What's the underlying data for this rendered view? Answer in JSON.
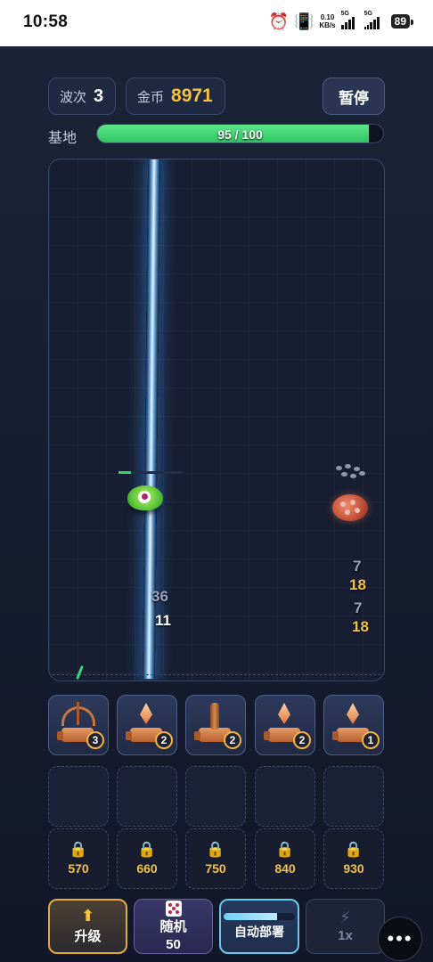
{
  "status_bar": {
    "time": "10:58",
    "net_speed_value": "0.10",
    "net_speed_unit": "KB/s",
    "sim1_label": "5G",
    "sim2_label": "5G",
    "battery": "89",
    "icons": [
      "alarm-icon",
      "vibrate-icon",
      "signal-icon",
      "signal-icon",
      "battery-icon"
    ]
  },
  "hud": {
    "wave_label": "波次",
    "wave_value": "3",
    "gold_label": "金币",
    "gold_value": "8971",
    "pause_label": "暂停",
    "base_label": "基地",
    "base_hp_text": "95 / 100",
    "base_hp_fraction": 0.95
  },
  "arena": {
    "damage_numbers": [
      "36",
      "11",
      "7",
      "18",
      "7",
      "18"
    ],
    "enemy_hp_fraction": 0.2,
    "colors": {
      "laser": "#5fb4ff",
      "hp": "#35d46a",
      "gold": "#f7c33d"
    }
  },
  "towers": [
    {
      "type": "crossbow",
      "icon": "crossbow-tower-icon",
      "level": "3"
    },
    {
      "type": "crystal",
      "icon": "crystal-tower-icon",
      "level": "2"
    },
    {
      "type": "cannon",
      "icon": "cannon-tower-icon",
      "level": "2"
    },
    {
      "type": "crystal",
      "icon": "crystal-tower-icon",
      "level": "2"
    },
    {
      "type": "crystal",
      "icon": "crystal-tower-icon",
      "level": "1"
    }
  ],
  "empty_slots": 5,
  "locked_slots": [
    {
      "price": "570"
    },
    {
      "price": "660"
    },
    {
      "price": "750"
    },
    {
      "price": "840"
    },
    {
      "price": "930"
    }
  ],
  "actions": {
    "upgrade_label": "升级",
    "random_label": "随机",
    "random_cost": "50",
    "auto_label": "自动部署",
    "auto_progress": 0.75,
    "speed_label": "1x",
    "more_label": "•••"
  }
}
